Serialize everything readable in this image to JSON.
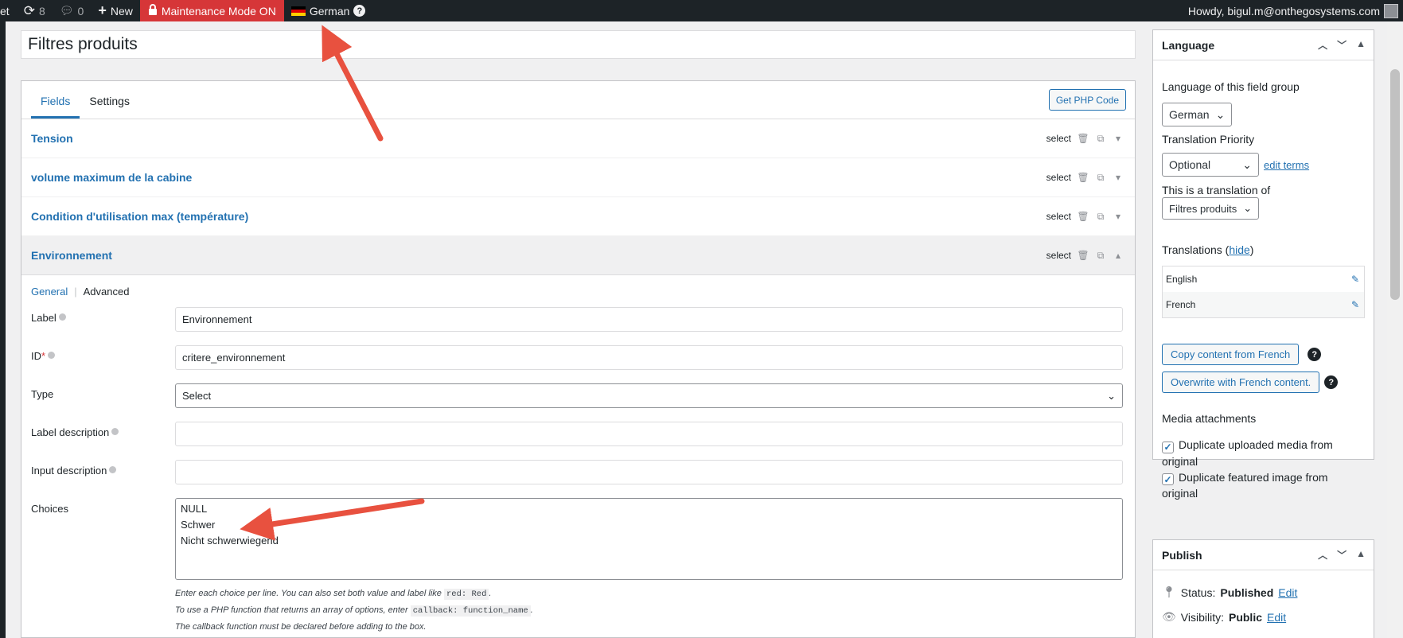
{
  "adminbar": {
    "site_fragment": "et",
    "updates_count": "8",
    "comments_count": "0",
    "new_label": "New",
    "maintenance_label": "Maintenance Mode ON",
    "language_label": "German",
    "howdy": "Howdy, bigul.m@onthegosystems.com"
  },
  "post_title": "Filtres produits",
  "tabs": {
    "fields": "Fields",
    "settings": "Settings",
    "get_php": "Get PHP Code"
  },
  "fields": [
    {
      "name": "Tension",
      "type": "select"
    },
    {
      "name": "volume maximum de la cabine",
      "type": "select"
    },
    {
      "name": "Condition d'utilisation max (température)",
      "type": "select"
    },
    {
      "name": "Environnement",
      "type": "select"
    }
  ],
  "editor": {
    "sub_tabs": {
      "general": "General",
      "advanced": "Advanced"
    },
    "label_label": "Label",
    "label_value": "Environnement",
    "id_label": "ID",
    "id_required": "*",
    "id_value": "critere_environnement",
    "type_label": "Type",
    "type_value": "Select",
    "label_description_label": "Label description",
    "input_description_label": "Input description",
    "choices_label": "Choices",
    "choices_value": "NULL\nSchwer\nNicht schwerwiegend",
    "help_line1_a": "Enter each choice per line. You can also set both value and label like ",
    "help_line1_code": "red: Red",
    "help_line1_b": ".",
    "help_line2_a": "To use a PHP function that returns an array of options, enter ",
    "help_line2_code": "callback: function_name",
    "help_line2_b": ".",
    "help_line3": "The callback function must be declared before adding to the box."
  },
  "language_box": {
    "title": "Language",
    "lang_of_group_label": "Language of this field group",
    "lang_value": "German",
    "priority_label": "Translation Priority",
    "priority_value": "Optional",
    "edit_terms": "edit terms",
    "translation_of_label": "This is a translation of",
    "translation_of_value": "Filtres produits",
    "translations_label": "Translations",
    "hide_link": "hide",
    "translations": [
      "English",
      "French"
    ],
    "copy_btn": "Copy content from French",
    "overwrite_btn": "Overwrite with French content.",
    "media_label": "Media attachments",
    "dup_media": "Duplicate uploaded media from original",
    "dup_featured": "Duplicate featured image from original"
  },
  "publish_box": {
    "title": "Publish",
    "status_label": "Status:",
    "status_value": "Published",
    "visibility_label": "Visibility:",
    "visibility_value": "Public",
    "edit": "Edit"
  },
  "colors": {
    "accent": "#2271b1",
    "adminbar": "#1d2327",
    "maintenance": "#d63638",
    "arrow": "#e8513f"
  }
}
